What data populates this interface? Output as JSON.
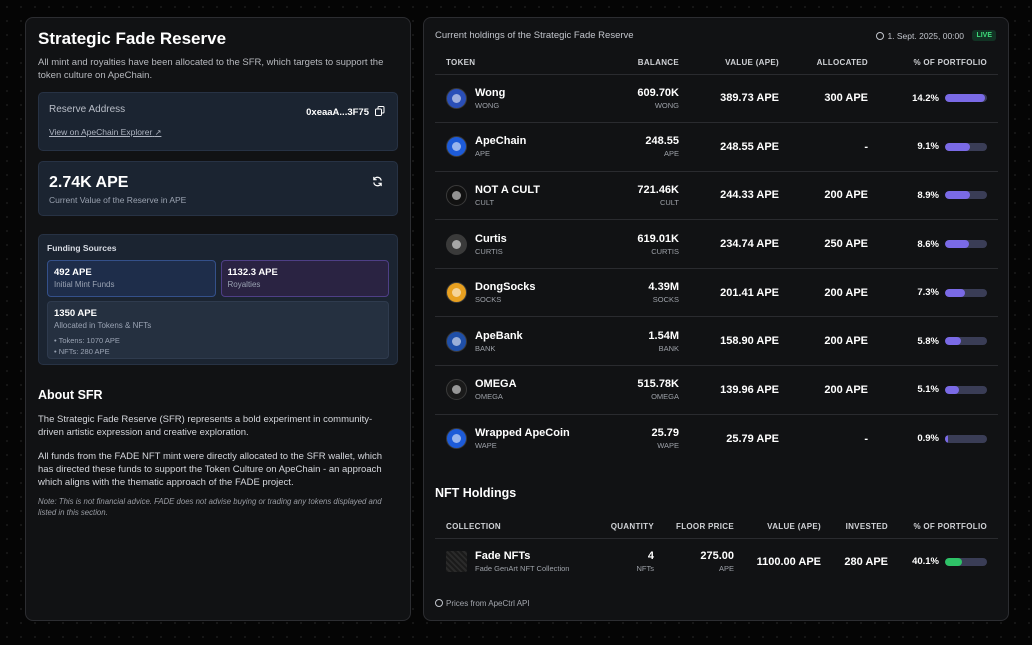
{
  "left": {
    "title": "Strategic Fade Reserve",
    "subtitle": "All mint and royalties have been allocated to the SFR, which targets to support the token culture on ApeChain.",
    "reserve_label": "Reserve Address",
    "reserve_address": "0xeaaA...3F75",
    "explorer_link": "View on ApeChain Explorer",
    "value": "2.74K APE",
    "value_label": "Current Value of the Reserve in APE",
    "funding": {
      "title": "Funding Sources",
      "mint_value": "492 APE",
      "mint_label": "Initial Mint Funds",
      "royalties_value": "1132.3 APE",
      "royalties_label": "Royalties",
      "allocated_value": "1350 APE",
      "allocated_label": "Allocated in Tokens & NFTs",
      "tokens_line": "• Tokens: 1070 APE",
      "nfts_line": "• NFTs: 280 APE"
    },
    "about_title": "About SFR",
    "about_p1": "The Strategic Fade Reserve (SFR) represents a bold experiment in community-driven artistic expression and creative exploration.",
    "about_p2": "All funds from the FADE NFT mint were directly allocated to the SFR wallet, which has directed these funds to support the Token Culture on ApeChain - an approach which aligns with the thematic approach of the FADE project.",
    "note": "Note: This is not financial advice. FADE does not advise buying or trading any tokens displayed and listed in this section."
  },
  "right": {
    "heading": "Current holdings of the Strategic Fade Reserve",
    "date": "1. Sept. 2025, 00:00",
    "live": "LIVE",
    "columns": [
      "TOKEN",
      "BALANCE",
      "VALUE (APE)",
      "ALLOCATED",
      "% OF PORTFOLIO"
    ],
    "tokens": [
      {
        "name": "Wong",
        "symbol": "WONG",
        "balance": "609.70K",
        "value": "389.73 APE",
        "allocated": "300 APE",
        "pct": "14.2%",
        "pct_value": 14.2,
        "logo_color": "#2a4fb8"
      },
      {
        "name": "ApeChain",
        "symbol": "APE",
        "balance": "248.55",
        "value": "248.55 APE",
        "allocated": "-",
        "pct": "9.1%",
        "pct_value": 9.1,
        "logo_color": "#1d5bd8"
      },
      {
        "name": "NOT A CULT",
        "symbol": "CULT",
        "balance": "721.46K",
        "value": "244.33 APE",
        "allocated": "200 APE",
        "pct": "8.9%",
        "pct_value": 8.9,
        "logo_color": "#111111"
      },
      {
        "name": "Curtis",
        "symbol": "CURTIS",
        "balance": "619.01K",
        "value": "234.74 APE",
        "allocated": "250 APE",
        "pct": "8.6%",
        "pct_value": 8.6,
        "logo_color": "#3a3a3a"
      },
      {
        "name": "DongSocks",
        "symbol": "SOCKS",
        "balance": "4.39M",
        "value": "201.41 APE",
        "allocated": "200 APE",
        "pct": "7.3%",
        "pct_value": 7.3,
        "logo_color": "#e8a020"
      },
      {
        "name": "ApeBank",
        "symbol": "BANK",
        "balance": "1.54M",
        "value": "158.90 APE",
        "allocated": "200 APE",
        "pct": "5.8%",
        "pct_value": 5.8,
        "logo_color": "#1f4fa8"
      },
      {
        "name": "OMEGA",
        "symbol": "OMEGA",
        "balance": "515.78K",
        "value": "139.96 APE",
        "allocated": "200 APE",
        "pct": "5.1%",
        "pct_value": 5.1,
        "logo_color": "#1a1a1a"
      },
      {
        "name": "Wrapped ApeCoin",
        "symbol": "WAPE",
        "balance": "25.79",
        "value": "25.79 APE",
        "allocated": "-",
        "pct": "0.9%",
        "pct_value": 0.9,
        "logo_color": "#1d5bd8"
      }
    ],
    "nft_title": "NFT Holdings",
    "nft_columns": [
      "COLLECTION",
      "QUANTITY",
      "FLOOR PRICE",
      "VALUE (APE)",
      "INVESTED",
      "% OF PORTFOLIO"
    ],
    "nfts": [
      {
        "name": "Fade NFTs",
        "desc": "Fade GenArt NFT Collection",
        "quantity": "4",
        "quantity_unit": "NFTs",
        "floor": "275.00",
        "floor_unit": "APE",
        "value": "1100.00 APE",
        "invested": "280 APE",
        "pct": "40.1%",
        "pct_value": 40.1
      }
    ],
    "prices_from": "Prices from ApeCtrl API"
  },
  "colors": {
    "bar_token": "#7a6ae6",
    "bar_nft": "#2ec267",
    "live": "#3ddc7a"
  }
}
